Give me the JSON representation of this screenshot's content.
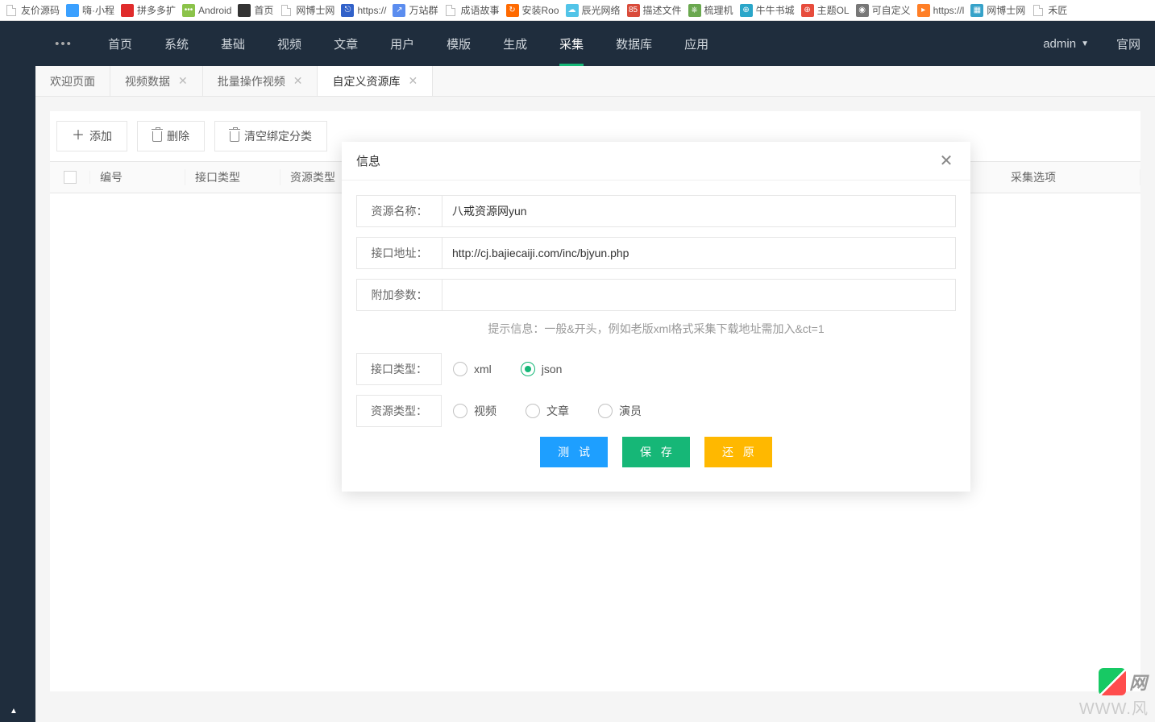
{
  "bookmarks": [
    {
      "label": "友价源码",
      "color": "#ccc",
      "type": "page"
    },
    {
      "label": "嗨·小程",
      "color": "#3aa0ff",
      "type": "color"
    },
    {
      "label": "拼多多扩",
      "color": "#e02c2c",
      "type": "color"
    },
    {
      "label": "Android",
      "color": "#8bc34a",
      "type": "color",
      "text": "•••"
    },
    {
      "label": "首页",
      "color": "#333",
      "type": "color"
    },
    {
      "label": "网博士网",
      "color": "#ccc",
      "type": "page"
    },
    {
      "label": "https://",
      "color": "#3161c9",
      "type": "color",
      "text": "⎋"
    },
    {
      "label": "万站群",
      "color": "#5b8def",
      "type": "color",
      "text": "↗"
    },
    {
      "label": "成语故事",
      "color": "#ccc",
      "type": "page"
    },
    {
      "label": "安装Roo",
      "color": "#ff6a00",
      "type": "color",
      "text": "↻"
    },
    {
      "label": "辰光网络",
      "color": "#52c4e8",
      "type": "color",
      "text": "☁"
    },
    {
      "label": "描述文件",
      "color": "#d94b3a",
      "type": "color",
      "text": "85"
    },
    {
      "label": "梳理机",
      "color": "#6aa84f",
      "type": "color",
      "text": "⎈"
    },
    {
      "label": "牛牛书城",
      "color": "#2aa6c9",
      "type": "color",
      "text": "⊕"
    },
    {
      "label": "主题OL",
      "color": "#e74c3c",
      "type": "color",
      "text": "⊕"
    },
    {
      "label": "可自定义",
      "color": "#777",
      "type": "color",
      "text": "◉"
    },
    {
      "label": "https://l",
      "color": "#ff7f27",
      "type": "color",
      "text": "▸"
    },
    {
      "label": "网博士网",
      "color": "#36a2c9",
      "type": "color",
      "text": "▦"
    },
    {
      "label": "禾匠",
      "color": "#ccc",
      "type": "page"
    }
  ],
  "topnav": {
    "items": [
      "首页",
      "系统",
      "基础",
      "视频",
      "文章",
      "用户",
      "模版",
      "生成",
      "采集",
      "数据库",
      "应用"
    ],
    "active": 8,
    "user": "admin",
    "extlink": "官网"
  },
  "tabs": [
    {
      "label": "欢迎页面",
      "closable": false
    },
    {
      "label": "视频数据",
      "closable": true
    },
    {
      "label": "批量操作视频",
      "closable": true
    },
    {
      "label": "自定义资源库",
      "closable": true,
      "active": true
    }
  ],
  "toolbar": {
    "add": "添加",
    "delete": "删除",
    "clear": "清空绑定分类"
  },
  "thead": {
    "col1": "编号",
    "col2": "接口类型",
    "col3": "资源类型",
    "last": "采集选项"
  },
  "modal": {
    "title": "信息",
    "fields": {
      "name_label": "资源名称：",
      "name_value": "八戒资源网yun",
      "url_label": "接口地址：",
      "url_value": "http://cj.bajiecaiji.com/inc/bjyun.php",
      "param_label": "附加参数：",
      "param_value": "",
      "hint": "提示信息：一般&开头，例如老版xml格式采集下载地址需加入&ct=1",
      "iface_label": "接口类型：",
      "iface_opts": [
        "xml",
        "json"
      ],
      "iface_sel": 1,
      "res_label": "资源类型：",
      "res_opts": [
        "视频",
        "文章",
        "演员"
      ],
      "res_sel": -1
    },
    "buttons": {
      "test": "测 试",
      "save": "保 存",
      "reset": "还 原"
    }
  },
  "watermark": {
    "brand": "网",
    "sub": "WWW.风"
  }
}
